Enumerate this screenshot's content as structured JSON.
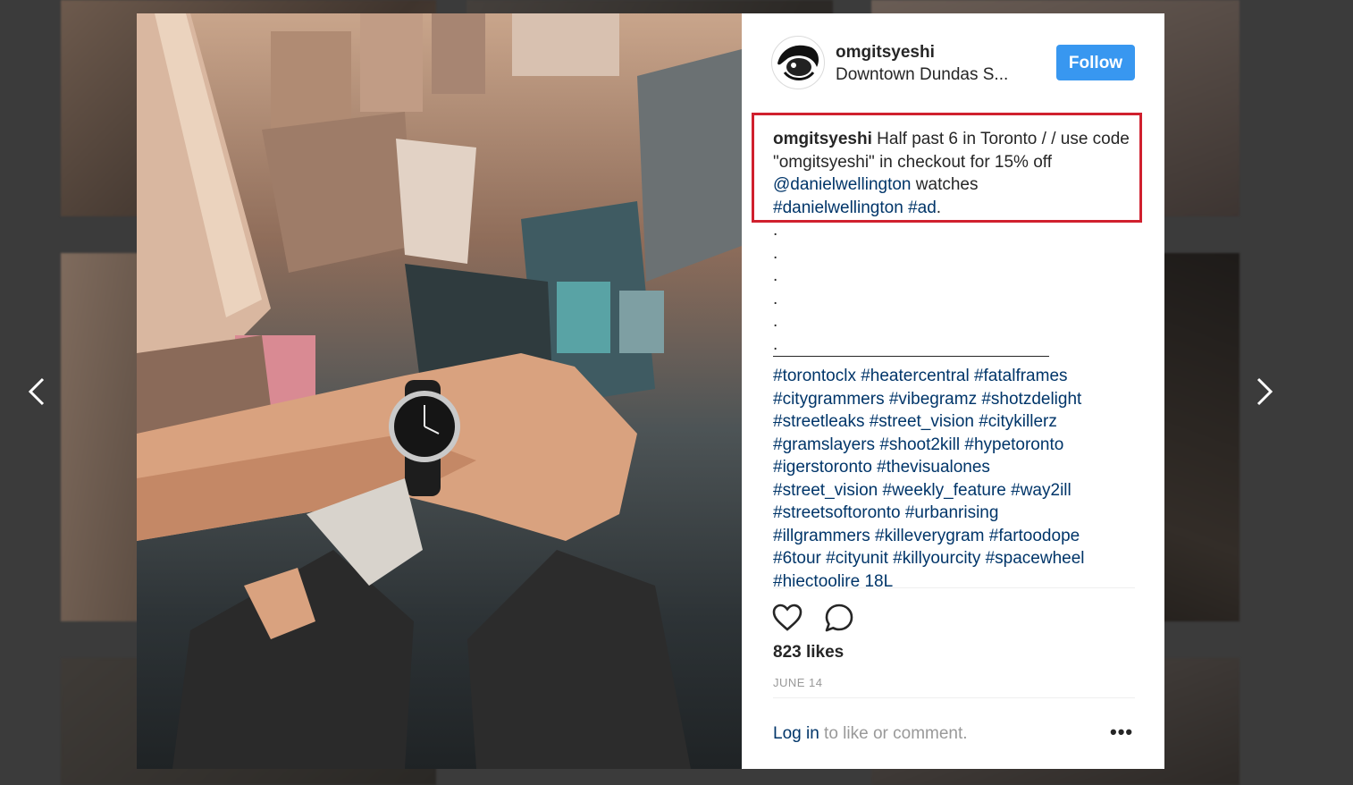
{
  "post": {
    "username": "omgitsyeshi",
    "location": "Downtown Dundas S...",
    "follow_label": "Follow",
    "caption": {
      "username": "omgitsyeshi",
      "text_line1": " Half past 6 in Toronto / / use code \"omgitsyeshi\" in checkout for 15% off ",
      "mention": "@danielwellington",
      "text_after_mention": " watches ",
      "hashtag_brand": "#danielwellington",
      "hashtag_ad": "#ad",
      "period": ".",
      "dots": [
        ".",
        ".",
        ".",
        ".",
        ".",
        "."
      ],
      "hashtag_lines": [
        "#torontoclx #heatercentral #fatalframes",
        "#citygrammers #vibegramz #shotzdelight",
        "#streetleaks #street_vision #citykillerz",
        "#gramslayers #shoot2kill #hypetoronto",
        "#igerstoronto #thevisualones",
        "#street_vision #weekly_feature #way2ill",
        "#streetsoftoronto #urbanrising",
        "#illgrammers #killeverygram #fartoodope",
        "#6tour #cityunit #killyourcity #spacewheel",
        "#hiectoolire 18L"
      ]
    },
    "likes": "823 likes",
    "date": "JUNE 14",
    "login_link": "Log in",
    "login_rest": " to like or comment.",
    "more_label": "•••"
  },
  "icons": {
    "like": "heart-icon",
    "comment": "comment-icon",
    "prev": "chevron-left-icon",
    "next": "chevron-right-icon"
  },
  "colors": {
    "follow_button": "#3897f0",
    "link": "#003569",
    "highlight_box": "#d0202e"
  }
}
